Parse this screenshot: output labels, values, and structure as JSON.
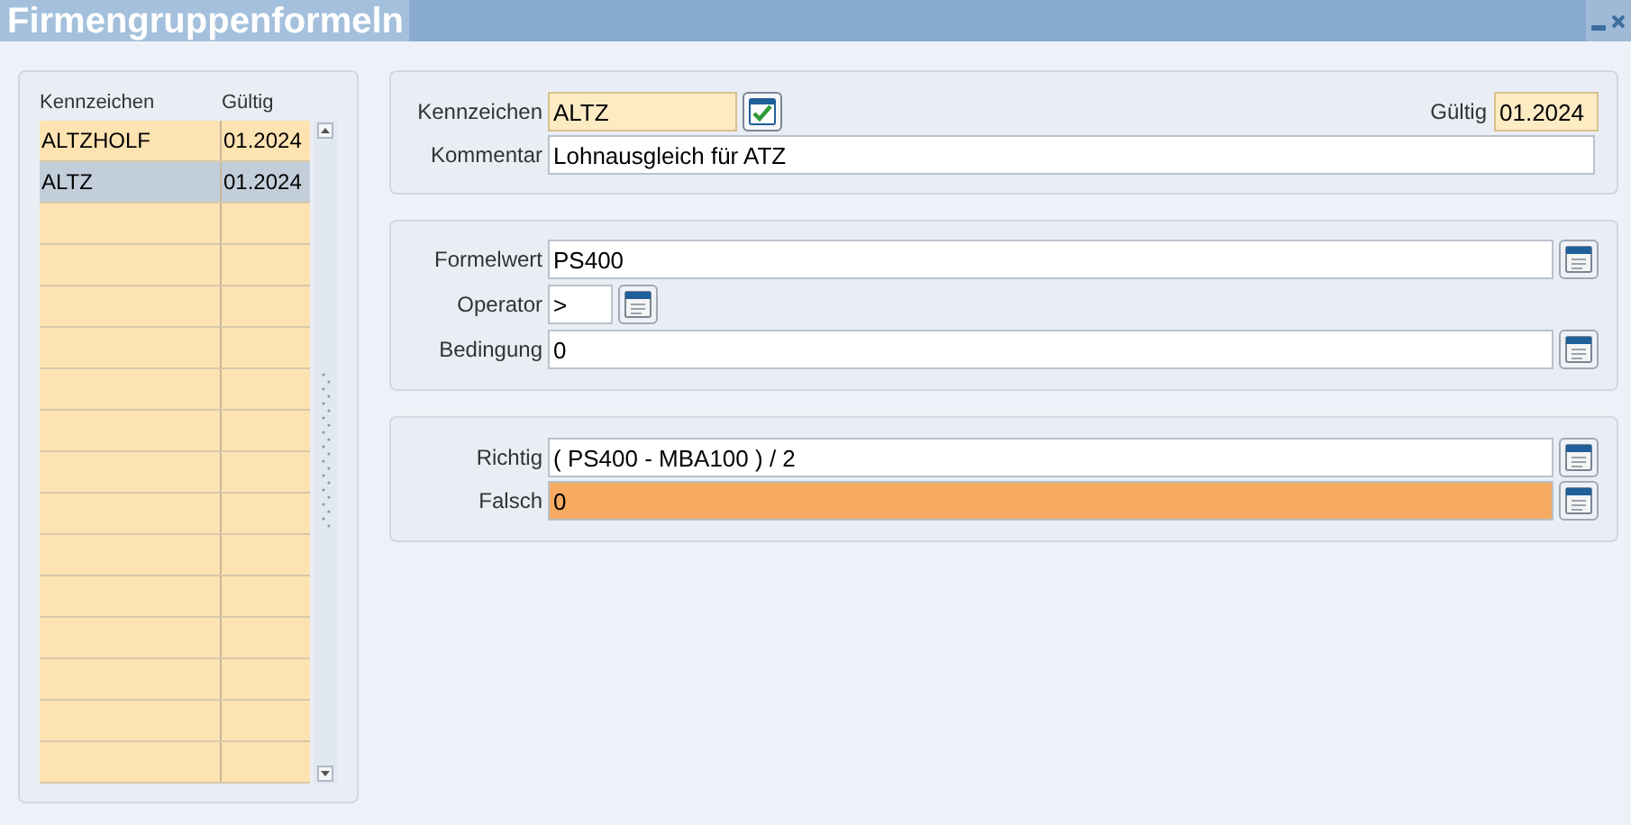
{
  "window": {
    "title": "Firmengruppenformeln"
  },
  "list": {
    "columns": [
      "Kennzeichen",
      "Gültig"
    ],
    "rows": [
      {
        "kennzeichen": "ALTZHOLF",
        "gueltig": "01.2024",
        "selected": false
      },
      {
        "kennzeichen": "ALTZ",
        "gueltig": "01.2024",
        "selected": true
      }
    ]
  },
  "header": {
    "kennzeichen": {
      "label": "Kennzeichen",
      "value": "ALTZ",
      "highlighted": true,
      "focused": false
    },
    "gueltig": {
      "label": "Gültig",
      "value": "01.2024",
      "highlighted": true,
      "focused": false
    },
    "kommentar": {
      "label": "Kommentar",
      "value": "Lohnausgleich für ATZ",
      "highlighted": false,
      "focused": false
    }
  },
  "condition": {
    "formelwert": {
      "label": "Formelwert",
      "value": "PS400",
      "highlighted": false,
      "focused": false
    },
    "operator": {
      "label": "Operator",
      "value": ">",
      "highlighted": false,
      "focused": false
    },
    "bedingung": {
      "label": "Bedingung",
      "value": "0",
      "highlighted": false,
      "focused": false
    }
  },
  "result": {
    "richtig": {
      "label": "Richtig",
      "value": "( PS400 - MBA100 ) / 2",
      "highlighted": false,
      "focused": false
    },
    "falsch": {
      "label": "Falsch",
      "value": "0",
      "highlighted": false,
      "focused": true
    }
  }
}
